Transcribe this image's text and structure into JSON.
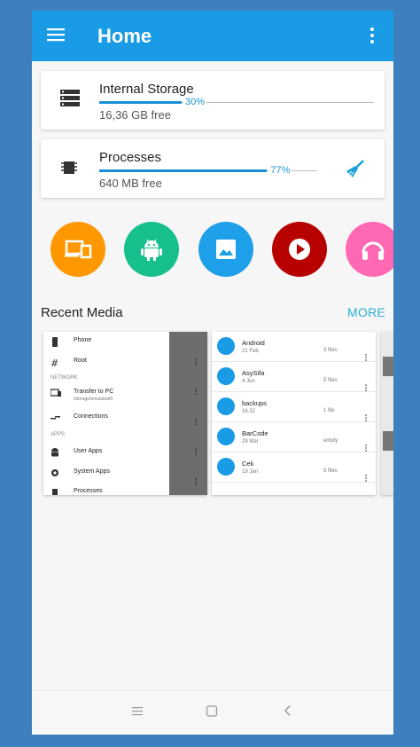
{
  "header": {
    "title": "Home",
    "menu_icon": "hamburger-menu-icon",
    "overflow_icon": "more-vertical-icon"
  },
  "storage": {
    "title": "Internal Storage",
    "subtitle": "16,36 GB free",
    "percent_label": "30%",
    "fraction": 0.3
  },
  "processes": {
    "title": "Processes",
    "subtitle": "640 MB free",
    "percent_label": "77%",
    "fraction": 0.77,
    "clean_icon": "broom-icon"
  },
  "categories": [
    {
      "name": "apps",
      "color": "#ff9800",
      "icon": "devices-icon"
    },
    {
      "name": "android",
      "color": "#17bf8d",
      "icon": "android-icon"
    },
    {
      "name": "images",
      "color": "#1e9fea",
      "icon": "image-icon"
    },
    {
      "name": "video",
      "color": "#b70000",
      "icon": "play-icon"
    },
    {
      "name": "audio",
      "color": "#ff69b4",
      "icon": "headphones-icon"
    }
  ],
  "recent": {
    "title": "Recent Media",
    "more": "MORE",
    "nav_preview": {
      "items": [
        {
          "label": "Phone",
          "icon": "phone-icon"
        },
        {
          "label": "Root",
          "icon": "hash-icon"
        }
      ],
      "network_label": "NETWORK",
      "network_items": [
        {
          "label": "Transfer to PC",
          "sub": "/storage/emulated/0",
          "icon": "transfer-icon"
        },
        {
          "label": "Connections",
          "icon": "connections-icon"
        }
      ],
      "apps_label": "APPS",
      "apps_items": [
        {
          "label": "User Apps",
          "icon": "android-icon"
        },
        {
          "label": "System Apps",
          "icon": "gear-icon"
        },
        {
          "label": "Processes",
          "icon": "chip-icon"
        }
      ]
    },
    "files": [
      {
        "name": "Android",
        "date": "21 Feb",
        "count": "3 files"
      },
      {
        "name": "AsySifa",
        "date": "4 Jun",
        "count": "5 files"
      },
      {
        "name": "backups",
        "date": "16.32",
        "count": "1 file"
      },
      {
        "name": "BarCode",
        "date": "29 Mar",
        "count": "empty"
      },
      {
        "name": "Cek",
        "date": "19 Jan",
        "count": "5 files"
      }
    ]
  },
  "colors": {
    "accent": "#1a9be6",
    "background": "#3d80bd"
  }
}
